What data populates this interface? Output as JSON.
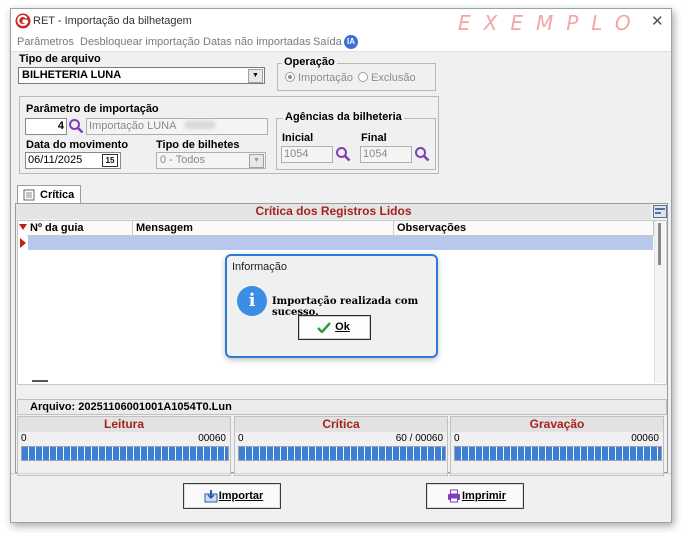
{
  "window": {
    "title": "RET - Importação da bilhetagem",
    "watermark": "EXEMPLO",
    "close_glyph": "✕"
  },
  "menu": {
    "items": [
      "Parâmetros",
      "Desbloquear importação",
      "Datas não importadas",
      "Saída"
    ],
    "ia_badge": "IA"
  },
  "form": {
    "tipo_arquivo_label": "Tipo de arquivo",
    "tipo_arquivo_value": "BILHETERIA LUNA",
    "operacao_label": "Operação",
    "op_importacao": "Importação",
    "op_exclusao": "Exclusão",
    "parametro_label": "Parâmetro de importação",
    "parametro_codigo": "4",
    "parametro_descricao": "Importação LUNA",
    "data_label": "Data do movimento",
    "data_value": "06/11/2025",
    "calendar_day": "15",
    "tipo_bilhetes_label": "Tipo de bilhetes",
    "tipo_bilhetes_value": "0 - Todos",
    "agencias_label": "Agências da bilheteria",
    "inicial_label": "Inicial",
    "inicial_value": "1054",
    "final_label": "Final",
    "final_value": "1054"
  },
  "tab": {
    "label": "Crítica"
  },
  "grid": {
    "title": "Crítica dos Registros Lidos",
    "columns": [
      "Nº da guia",
      "Mensagem",
      "Observações"
    ],
    "arquivo_label": "Arquivo:",
    "arquivo_value": "20251106001001A1054T0.Lun"
  },
  "progress": [
    {
      "title": "Leitura",
      "left": "0",
      "right": "00060",
      "fraction": 1.0
    },
    {
      "title": "Crítica",
      "left": "0",
      "right": "60 / 00060",
      "fraction": 1.0
    },
    {
      "title": "Gravação",
      "left": "0",
      "right": "00060",
      "fraction": 1.0
    }
  ],
  "buttons": {
    "importar": "Importar",
    "imprimir": "Imprimir"
  },
  "dialog": {
    "title": "Informação",
    "message": "Importação realizada com sucesso.",
    "ok": "Ok"
  },
  "colors": {
    "accent_red": "#a5231e",
    "dialog_border": "#2e7bd6",
    "progress_blue": "#3a7fd4",
    "selection": "#b8c8ec"
  }
}
